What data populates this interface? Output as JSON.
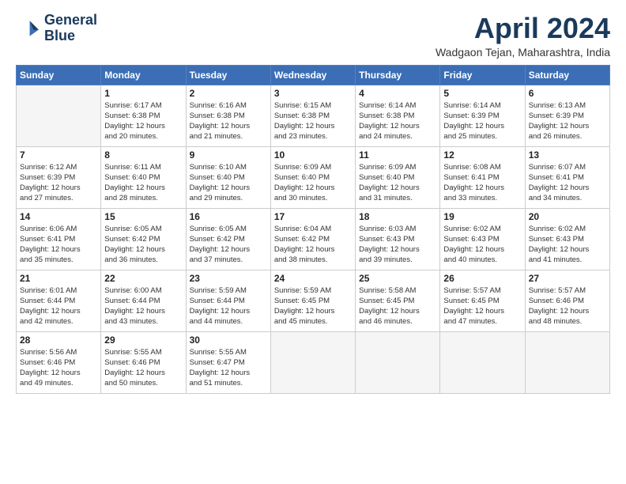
{
  "logo": {
    "line1": "General",
    "line2": "Blue"
  },
  "title": "April 2024",
  "location": "Wadgaon Tejan, Maharashtra, India",
  "days_header": [
    "Sunday",
    "Monday",
    "Tuesday",
    "Wednesday",
    "Thursday",
    "Friday",
    "Saturday"
  ],
  "weeks": [
    [
      {
        "day": "",
        "info": ""
      },
      {
        "day": "1",
        "info": "Sunrise: 6:17 AM\nSunset: 6:38 PM\nDaylight: 12 hours\nand 20 minutes."
      },
      {
        "day": "2",
        "info": "Sunrise: 6:16 AM\nSunset: 6:38 PM\nDaylight: 12 hours\nand 21 minutes."
      },
      {
        "day": "3",
        "info": "Sunrise: 6:15 AM\nSunset: 6:38 PM\nDaylight: 12 hours\nand 23 minutes."
      },
      {
        "day": "4",
        "info": "Sunrise: 6:14 AM\nSunset: 6:38 PM\nDaylight: 12 hours\nand 24 minutes."
      },
      {
        "day": "5",
        "info": "Sunrise: 6:14 AM\nSunset: 6:39 PM\nDaylight: 12 hours\nand 25 minutes."
      },
      {
        "day": "6",
        "info": "Sunrise: 6:13 AM\nSunset: 6:39 PM\nDaylight: 12 hours\nand 26 minutes."
      }
    ],
    [
      {
        "day": "7",
        "info": "Sunrise: 6:12 AM\nSunset: 6:39 PM\nDaylight: 12 hours\nand 27 minutes."
      },
      {
        "day": "8",
        "info": "Sunrise: 6:11 AM\nSunset: 6:40 PM\nDaylight: 12 hours\nand 28 minutes."
      },
      {
        "day": "9",
        "info": "Sunrise: 6:10 AM\nSunset: 6:40 PM\nDaylight: 12 hours\nand 29 minutes."
      },
      {
        "day": "10",
        "info": "Sunrise: 6:09 AM\nSunset: 6:40 PM\nDaylight: 12 hours\nand 30 minutes."
      },
      {
        "day": "11",
        "info": "Sunrise: 6:09 AM\nSunset: 6:40 PM\nDaylight: 12 hours\nand 31 minutes."
      },
      {
        "day": "12",
        "info": "Sunrise: 6:08 AM\nSunset: 6:41 PM\nDaylight: 12 hours\nand 33 minutes."
      },
      {
        "day": "13",
        "info": "Sunrise: 6:07 AM\nSunset: 6:41 PM\nDaylight: 12 hours\nand 34 minutes."
      }
    ],
    [
      {
        "day": "14",
        "info": "Sunrise: 6:06 AM\nSunset: 6:41 PM\nDaylight: 12 hours\nand 35 minutes."
      },
      {
        "day": "15",
        "info": "Sunrise: 6:05 AM\nSunset: 6:42 PM\nDaylight: 12 hours\nand 36 minutes."
      },
      {
        "day": "16",
        "info": "Sunrise: 6:05 AM\nSunset: 6:42 PM\nDaylight: 12 hours\nand 37 minutes."
      },
      {
        "day": "17",
        "info": "Sunrise: 6:04 AM\nSunset: 6:42 PM\nDaylight: 12 hours\nand 38 minutes."
      },
      {
        "day": "18",
        "info": "Sunrise: 6:03 AM\nSunset: 6:43 PM\nDaylight: 12 hours\nand 39 minutes."
      },
      {
        "day": "19",
        "info": "Sunrise: 6:02 AM\nSunset: 6:43 PM\nDaylight: 12 hours\nand 40 minutes."
      },
      {
        "day": "20",
        "info": "Sunrise: 6:02 AM\nSunset: 6:43 PM\nDaylight: 12 hours\nand 41 minutes."
      }
    ],
    [
      {
        "day": "21",
        "info": "Sunrise: 6:01 AM\nSunset: 6:44 PM\nDaylight: 12 hours\nand 42 minutes."
      },
      {
        "day": "22",
        "info": "Sunrise: 6:00 AM\nSunset: 6:44 PM\nDaylight: 12 hours\nand 43 minutes."
      },
      {
        "day": "23",
        "info": "Sunrise: 5:59 AM\nSunset: 6:44 PM\nDaylight: 12 hours\nand 44 minutes."
      },
      {
        "day": "24",
        "info": "Sunrise: 5:59 AM\nSunset: 6:45 PM\nDaylight: 12 hours\nand 45 minutes."
      },
      {
        "day": "25",
        "info": "Sunrise: 5:58 AM\nSunset: 6:45 PM\nDaylight: 12 hours\nand 46 minutes."
      },
      {
        "day": "26",
        "info": "Sunrise: 5:57 AM\nSunset: 6:45 PM\nDaylight: 12 hours\nand 47 minutes."
      },
      {
        "day": "27",
        "info": "Sunrise: 5:57 AM\nSunset: 6:46 PM\nDaylight: 12 hours\nand 48 minutes."
      }
    ],
    [
      {
        "day": "28",
        "info": "Sunrise: 5:56 AM\nSunset: 6:46 PM\nDaylight: 12 hours\nand 49 minutes."
      },
      {
        "day": "29",
        "info": "Sunrise: 5:55 AM\nSunset: 6:46 PM\nDaylight: 12 hours\nand 50 minutes."
      },
      {
        "day": "30",
        "info": "Sunrise: 5:55 AM\nSunset: 6:47 PM\nDaylight: 12 hours\nand 51 minutes."
      },
      {
        "day": "",
        "info": ""
      },
      {
        "day": "",
        "info": ""
      },
      {
        "day": "",
        "info": ""
      },
      {
        "day": "",
        "info": ""
      }
    ]
  ]
}
